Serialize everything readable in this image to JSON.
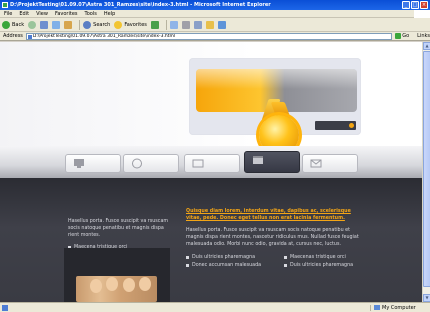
{
  "window": {
    "title": "D:\\ProjektTesting\\01.09.07\\Astra 301_Ramzes\\site\\index-3.html - Microsoft Internet Explorer",
    "buttons": [
      "_",
      "□",
      "×"
    ]
  },
  "menu": [
    "File",
    "Edit",
    "View",
    "Favorites",
    "Tools",
    "Help"
  ],
  "toolbar": {
    "back_label": "Back",
    "search_label": "Search",
    "favorites_label": "Favorites"
  },
  "address": {
    "label": "Address",
    "value": "D:\\ProjektTesting\\01.09.07\\Astra 301_Ramzes\\site\\index-3.html",
    "go_label": "Go",
    "links_label": "Links"
  },
  "left_column": {
    "text": "Hasellus porta. Fusce suscipit va rsuscam socis natoque penatibu et magnis dispa rient montes.",
    "more_label": "Maecena tristique orci"
  },
  "right_column": {
    "headline": "Quisque diam lorem, interdum vitae, dapibus ac, scelerisque vitae, pede. Donec eget tellus non erat lacinia fermentum.",
    "body": "Hasellus porta. Fusce suscipit va rsuscam socis natoque penatibu et magnis dispa rient montes, nascetur ridiculus mus. Nullad fusce feugiat malesuada odio. Morbi nunc odio, gravida at, cursus nec, luctus.",
    "bullets": [
      "Duis ultricies pharemagna",
      "Maecenas tristique orci",
      "Donec accumsan malesuada",
      "Duis ultricies pharemagna"
    ]
  },
  "status": {
    "text": "",
    "zone_label": "My Computer"
  },
  "colors": {
    "accent": "#f3a516",
    "dark_bg": "#3a3b43",
    "xp_blue": "#0a4fd6"
  }
}
